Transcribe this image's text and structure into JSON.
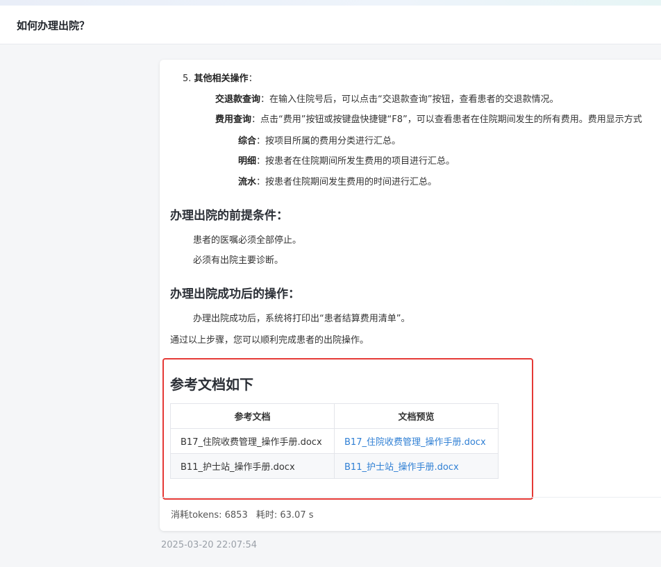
{
  "header": {
    "title": "如何办理出院？"
  },
  "answer": {
    "other_ops": {
      "heading_num": "5.",
      "heading": "其他相关操作",
      "colon": "：",
      "refund_label": "交退款查询",
      "refund_text": "在输入住院号后，可以点击“交退款查询”按钮，查看患者的交退款情况。",
      "fee_label": "费用查询",
      "fee_text": "点击“费用”按钮或按键盘快捷键“F8”，可以查看患者在住院期间发生的所有费用。费用显示方式",
      "summary_label": "综合",
      "summary_text": "按项目所属的费用分类进行汇总。",
      "detail_label": "明细",
      "detail_text": "按患者在住院期间所发生费用的项目进行汇总。",
      "flow_label": "流水",
      "flow_text": "按患者住院期间发生费用的时间进行汇总。"
    },
    "prereq": {
      "title": "办理出院的前提条件：",
      "items": [
        "患者的医嘱必须全部停止。",
        "必须有出院主要诊断。"
      ]
    },
    "after": {
      "title": "办理出院成功后的操作：",
      "text": "办理出院成功后，系统将打印出“患者结算费用清单”。"
    },
    "conclusion": "通过以上步骤，您可以顺利完成患者的出院操作。"
  },
  "references": {
    "title": "参考文档如下",
    "columns": [
      "参考文档",
      "文档预览"
    ],
    "rows": [
      {
        "doc": "B17_住院收费管理_操作手册.docx",
        "preview": "B17_住院收费管理_操作手册.docx"
      },
      {
        "doc": "B11_护士站_操作手册.docx",
        "preview": "B11_护士站_操作手册.docx"
      }
    ]
  },
  "stats": {
    "tokens": "消耗tokens: 6853",
    "time": "耗时: 63.07 s"
  },
  "timestamp": "2025-03-20 22:07:54",
  "colors": {
    "highlight_border": "#e53935",
    "link": "#2f7fd4"
  }
}
